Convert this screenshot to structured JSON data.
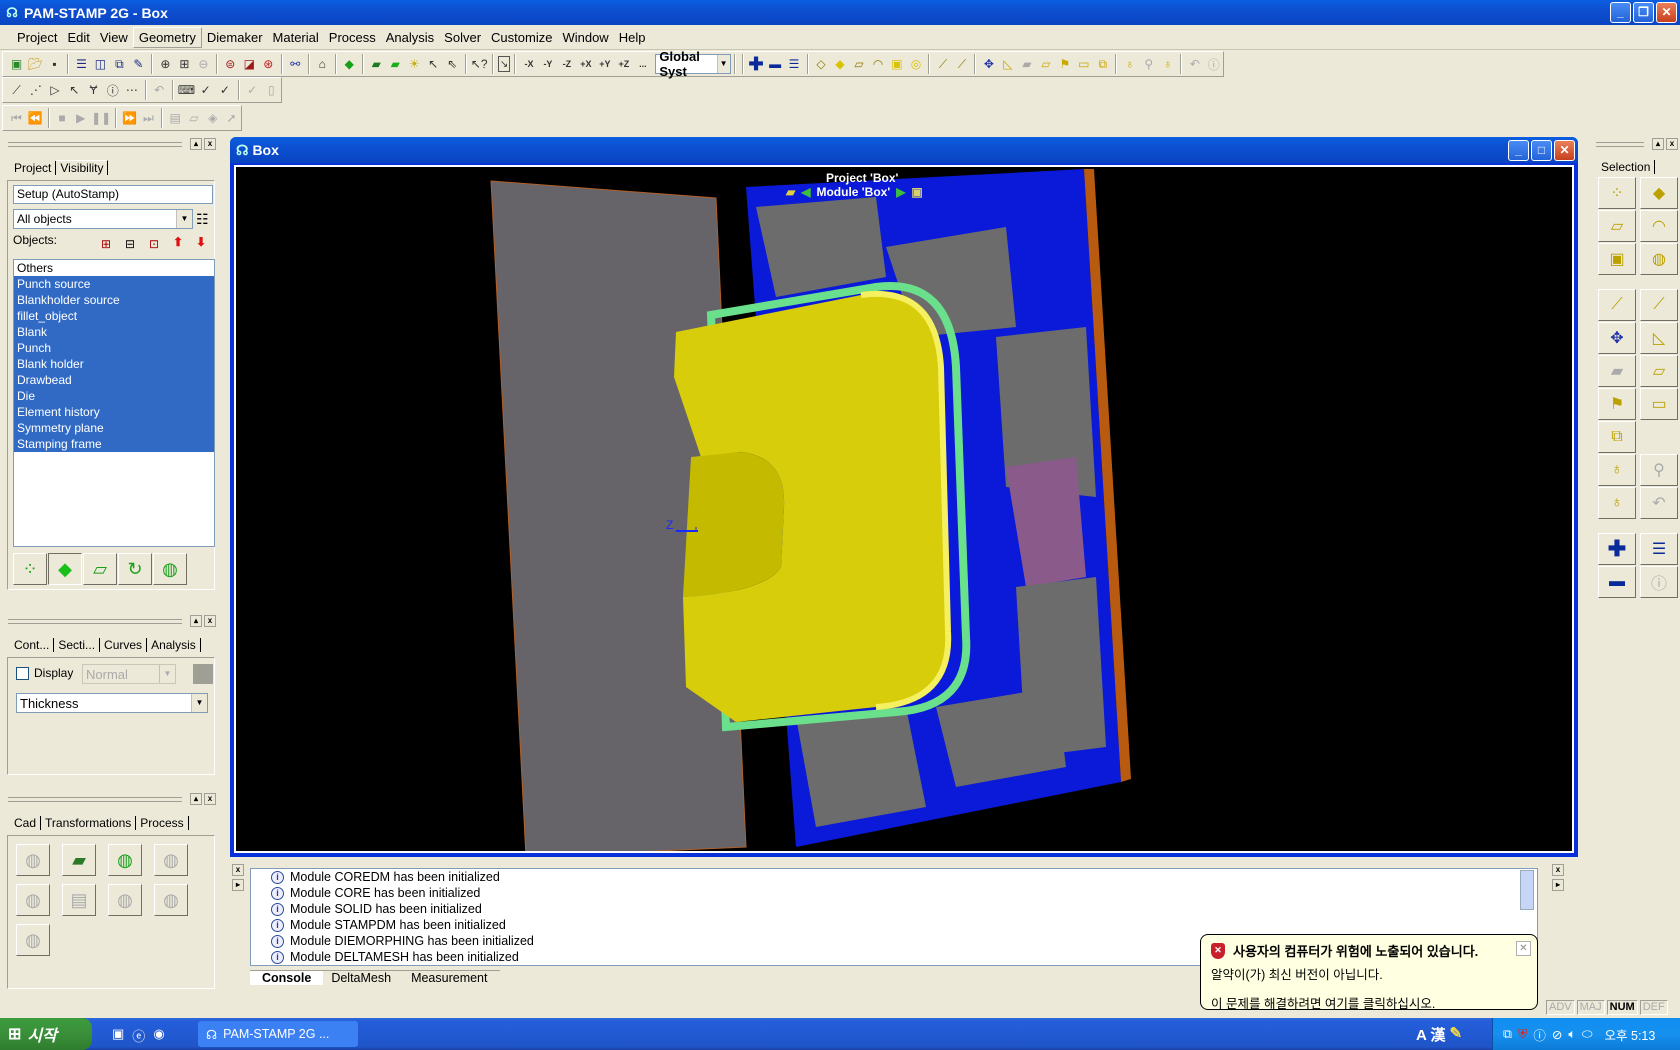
{
  "window": {
    "title": "PAM-STAMP 2G - Box",
    "controls": [
      "minimize",
      "restore",
      "close"
    ]
  },
  "menu": [
    "Project",
    "Edit",
    "View",
    "Geometry",
    "Diemaker",
    "Material",
    "Process",
    "Analysis",
    "Solver",
    "Customize",
    "Window",
    "Help"
  ],
  "menu_active": "Geometry",
  "toolbar": {
    "coord_system": "Global Syst",
    "row1_icons": [
      "new-project-icon",
      "open-icon",
      "save-icon",
      "split-horizontal-icon",
      "split-vertical-icon",
      "cascade-icon",
      "edit-icon",
      "zoom-box-icon",
      "zoom-fit-icon",
      "zoom-out-icon",
      "zoom-icon",
      "fit-all-icon",
      "center-icon",
      "measure-icon",
      "camera-icon",
      "solid-icon",
      "shade-icon",
      "shade-smooth-icon",
      "light-icon",
      "select-icon",
      "multi-select-icon",
      "help-pointer-icon",
      "reset-view-icon",
      "view-minus-x-icon",
      "view-minus-y-icon",
      "view-minus-z-icon",
      "view-plus-x-icon",
      "view-plus-y-icon",
      "view-plus-z-icon",
      "view-more-icon"
    ],
    "view_labels": [
      "-X",
      "-Y",
      "-Z",
      "+X",
      "+Y",
      "+Z",
      "..."
    ],
    "row1b_icons": [
      "add-icon",
      "remove-icon",
      "replace-icon",
      "node-icon",
      "element-icon",
      "edge-icon",
      "curve-icon",
      "part-icon",
      "surface-icon",
      "pick-point-icon",
      "pick-line-icon",
      "transform-icon",
      "ruler-icon",
      "plane-icon",
      "face-icon",
      "flag-icon",
      "box-icon",
      "group-icon",
      "undo-sel-icon",
      "lock-icon",
      "redo-sel-icon",
      "undo-icon",
      "info-icon"
    ],
    "row2_icons": [
      "line-icon",
      "polyline-icon",
      "polygon-icon",
      "arc-icon",
      "branch-icon",
      "info-icon",
      "more-icon",
      "undo-icon",
      "keyboard-icon",
      "check-icon",
      "check-add-icon",
      "check-remove-icon",
      "delete-icon"
    ],
    "row3_icons": [
      "first-icon",
      "rewind-icon",
      "stop-icon",
      "play-icon",
      "pause-icon",
      "forward-icon",
      "last-icon",
      "doc-icon",
      "open-icon",
      "save-icon",
      "export-icon"
    ]
  },
  "project_panel": {
    "tabs": [
      "Project",
      "Visibility"
    ],
    "setup": "Setup (AutoStamp)",
    "filter": "All objects",
    "objects_label": "Objects:",
    "objects": [
      {
        "name": "Others",
        "selected": false
      },
      {
        "name": "Punch source",
        "selected": true
      },
      {
        "name": "Blankholder source",
        "selected": true
      },
      {
        "name": "fillet_object",
        "selected": true
      },
      {
        "name": "Blank",
        "selected": true
      },
      {
        "name": "Punch",
        "selected": true
      },
      {
        "name": "Blank holder",
        "selected": true
      },
      {
        "name": "Drawbead",
        "selected": true
      },
      {
        "name": "Die",
        "selected": true
      },
      {
        "name": "Element history",
        "selected": true
      },
      {
        "name": "Symmetry plane",
        "selected": true
      },
      {
        "name": "Stamping frame",
        "selected": true
      }
    ],
    "display_modes": [
      "nodes-icon",
      "shaded-icon",
      "wireframe-icon",
      "curves-icon",
      "surface-icon"
    ]
  },
  "contour_panel": {
    "tabs": [
      "Cont...",
      "Secti...",
      "Curves",
      "Analysis"
    ],
    "display_label": "Display",
    "display_checked": false,
    "display_mode": "Normal",
    "variable": "Thickness"
  },
  "cad_panel": {
    "tabs": [
      "Cad",
      "Transformations",
      "Process"
    ]
  },
  "viewport": {
    "title": "Box",
    "overlay_project": "Project 'Box'",
    "overlay_module": "Module 'Box'",
    "axis_label": "Z"
  },
  "console": {
    "lines": [
      "Module COREDM has been initialized",
      "Module CORE has been initialized",
      "Module SOLID has been initialized",
      "Module STAMPDM has been initialized",
      "Module DIEMORPHING has been initialized",
      "Module DELTAMESH has been initialized"
    ],
    "tabs": [
      "Console",
      "DeltaMesh",
      "Measurement"
    ],
    "active_tab": "Console"
  },
  "selection_panel": {
    "tab": "Selection"
  },
  "status_indicators": [
    {
      "label": "ADV",
      "on": false
    },
    {
      "label": "MAJ",
      "on": false
    },
    {
      "label": "NUM",
      "on": true
    },
    {
      "label": "DEF",
      "on": false
    }
  ],
  "balloon": {
    "title": "사용자의 컴퓨터가 위험에 노출되어 있습니다.",
    "line1": "알약이(가) 최신 버전이 아닙니다.",
    "line2": "이 문제를 해결하려면 여기를 클릭하십시오."
  },
  "taskbar": {
    "start": "시작",
    "task": "PAM-STAMP 2G ...",
    "ime": "A 漢",
    "clock": "오후 5:13"
  }
}
